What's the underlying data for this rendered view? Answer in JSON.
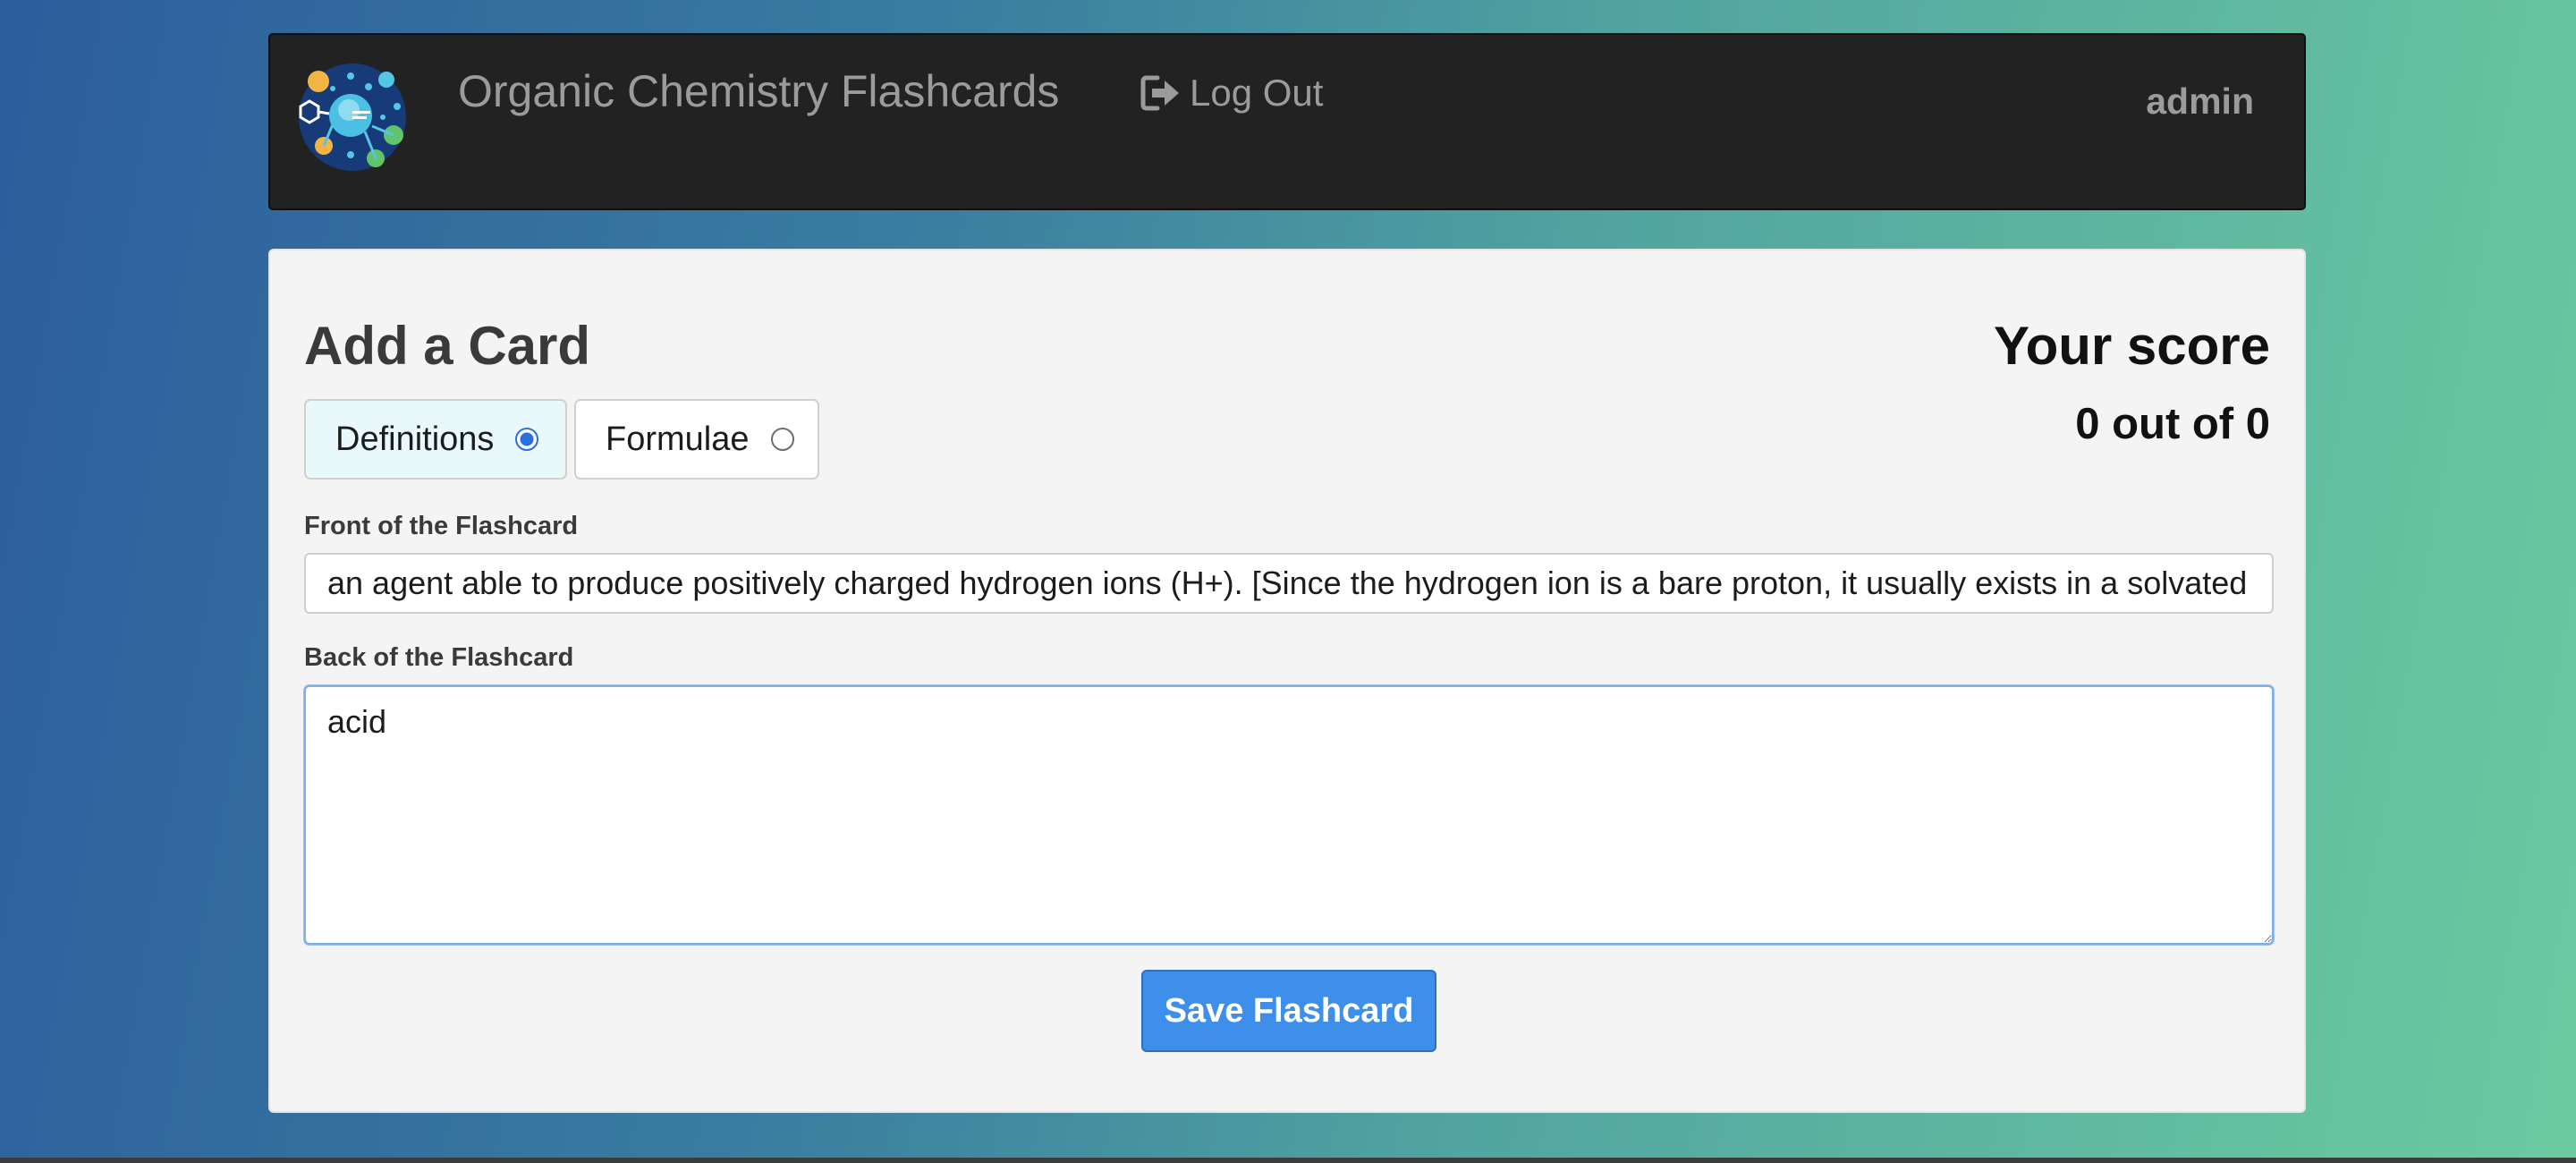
{
  "header": {
    "brand": "Organic Chemistry Flashcards",
    "logout_label": "Log Out",
    "logout_icon": "sign-out-icon",
    "username": "admin",
    "logo_icon": "molecule-logo",
    "background_color": "#222222"
  },
  "card_form": {
    "title": "Add a Card",
    "category_options": [
      {
        "label": "Definitions",
        "selected": true
      },
      {
        "label": "Formulae",
        "selected": false
      }
    ],
    "front_label": "Front of the Flashcard",
    "front_value": "an agent able to produce positively charged hydrogen ions (H+). [Since the hydrogen ion is a bare proton, it usually exists in a solvated form]",
    "back_label": "Back of the Flashcard",
    "back_value": "acid",
    "save_label": "Save Flashcard"
  },
  "score": {
    "title": "Your score",
    "value": "0 out of 0"
  },
  "colors": {
    "accent": "#3d8fea",
    "panel_background": "#f4f4f4",
    "gradient_start": "#2c5d9d",
    "gradient_end": "#6ccaa0"
  }
}
